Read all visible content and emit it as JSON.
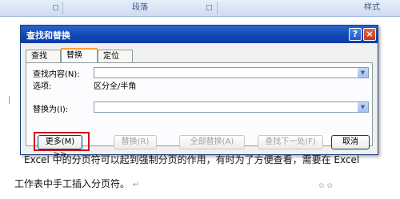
{
  "ribbon": {
    "groups": [
      "段落",
      "样式"
    ]
  },
  "document": {
    "line1": "Excel 中的分页符可以起到强制分页的作用，有时为了方便查看，需要在 Excel",
    "line2": "工作表中手工插入分页符。",
    "return_mark": "↵"
  },
  "dialog": {
    "title": "查找和替换",
    "help_label": "?",
    "close_label": "×",
    "tabs": [
      {
        "label": "查找(D)",
        "active": false
      },
      {
        "label": "替换(P)",
        "active": true
      },
      {
        "label": "定位(G)",
        "active": false
      }
    ],
    "find_label": "查找内容(N):",
    "find_value": "",
    "options_label": "选项:",
    "options_value": "区分全/半角",
    "replace_label": "替换为(I):",
    "replace_value": "",
    "buttons": {
      "more": "更多(M) >>",
      "replace": "替换(R)",
      "replace_all": "全部替换(A)",
      "find_next": "查找下一处(F)",
      "cancel": "取消"
    }
  },
  "colors": {
    "titlebar": "#0f46b2",
    "highlight_box": "#d0121b",
    "tab_accent": "#f4a533"
  },
  "icons": [
    "help-icon",
    "close-icon",
    "dropdown-arrow-icon"
  ]
}
